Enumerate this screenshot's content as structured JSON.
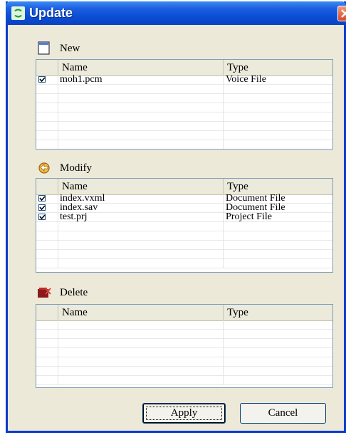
{
  "window": {
    "title": "Update"
  },
  "sections": [
    {
      "key": "new",
      "label": "New",
      "icon": "new-document-icon",
      "columns": [
        "Name",
        "Type"
      ],
      "rows": [
        {
          "checked": true,
          "name": "moh1.pcm",
          "type": "Voice File"
        }
      ]
    },
    {
      "key": "modify",
      "label": "Modify",
      "icon": "modify-icon",
      "columns": [
        "Name",
        "Type"
      ],
      "rows": [
        {
          "checked": true,
          "name": "index.vxml",
          "type": "Document File"
        },
        {
          "checked": true,
          "name": "index.sav",
          "type": "Document File"
        },
        {
          "checked": true,
          "name": "test.prj",
          "type": "Project File"
        }
      ]
    },
    {
      "key": "delete",
      "label": "Delete",
      "icon": "delete-icon",
      "columns": [
        "Name",
        "Type"
      ],
      "rows": []
    }
  ],
  "buttons": {
    "apply": "Apply",
    "cancel": "Cancel"
  }
}
